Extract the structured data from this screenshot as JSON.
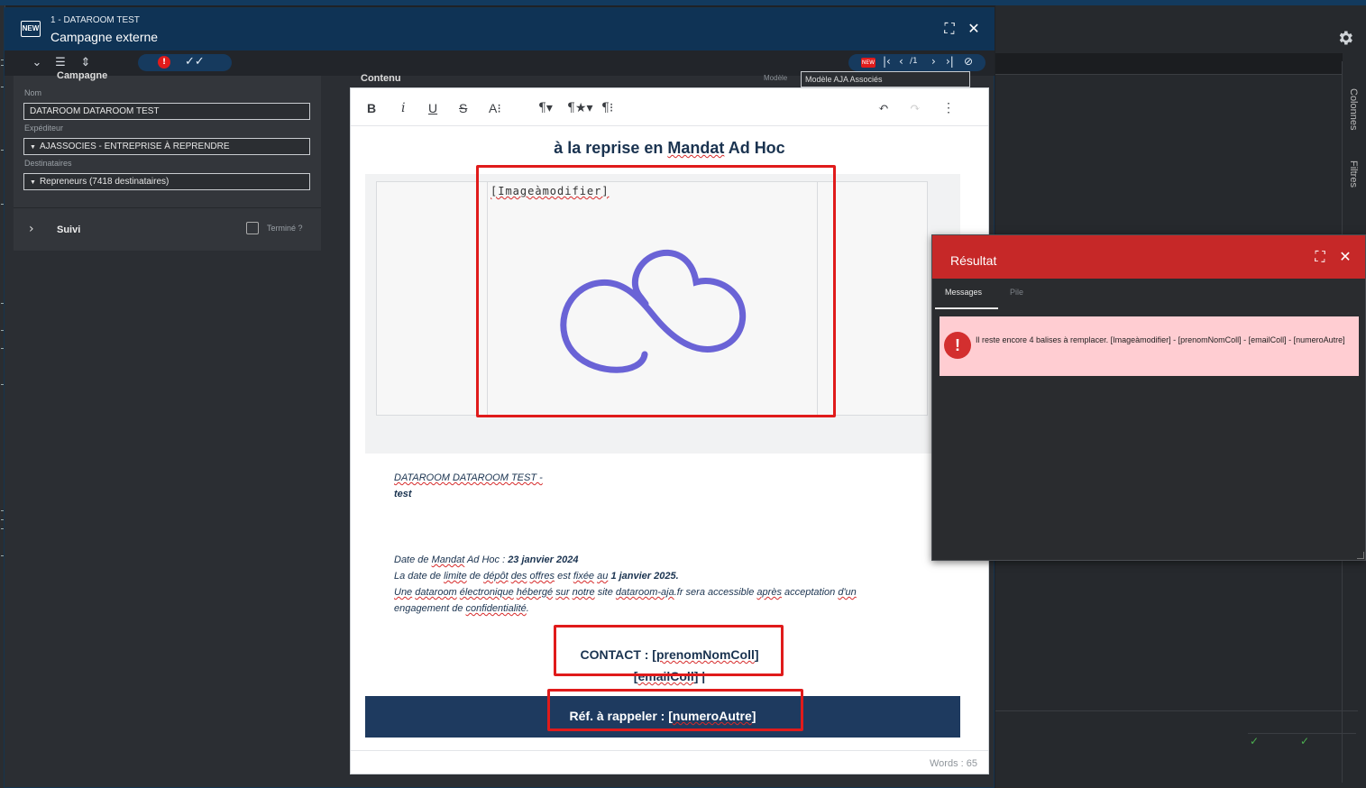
{
  "dialog": {
    "subtitle": "1 - DATAROOM TEST",
    "title": "Campagne externe",
    "new_badge": "NEW"
  },
  "toolbar": {
    "error_count": "!",
    "nav_page": "/1",
    "nav_badge": "NEW"
  },
  "form": {
    "section": "Campagne",
    "nom_label": "Nom",
    "nom_value": "DATAROOM DATAROOM TEST",
    "expediteur_label": "Expéditeur",
    "expediteur_value": "AJASSOCIES - ENTREPRISE À REPRENDRE",
    "destinataires_label": "Destinataires",
    "destinataires_value": "Repreneurs (7418 destinataires)",
    "suivi_label": "Suivi",
    "termine_label": "Terminé ?"
  },
  "editor": {
    "contenu_label": "Contenu",
    "modele_label": "Modèle",
    "modele_value": "Modèle AJA Associés",
    "heading_prefix": "à la reprise en ",
    "heading_mandat": "Mandat",
    "heading_suffix": " Ad Hoc",
    "image_placeholder": "[Imageàmodifier]",
    "company": "DATAROOM DATAROOM TEST -",
    "company_line2": "test",
    "line1_prefix": "Date de ",
    "line1_mandat": "Mandat",
    "line1_mid": " Ad Hoc : ",
    "line1_date": "23 janvier 2024",
    "line2_a": "La date de ",
    "line2_limite": "limite",
    "line2_b": " de ",
    "line2_depot": "dépôt",
    "line2_c": " ",
    "line2_des": "des",
    "line2_d": " ",
    "line2_offres": "offres",
    "line2_e": " est ",
    "line2_fixee": "fixée",
    "line2_f": " ",
    "line2_au": "au",
    "line2_g": " ",
    "line2_date": "1 janvier 2025.",
    "line3_une": "Une",
    "line3_a": " ",
    "line3_dataroom": "dataroom",
    "line3_b": " ",
    "line3_electronique": "électronique",
    "line3_c": " ",
    "line3_heberge": "hébergé",
    "line3_d": " ",
    "line3_sur": "sur",
    "line3_e": " ",
    "line3_notre": "notre",
    "line3_f": " site ",
    "line3_site": "dataroom-aja",
    "line3_g": ".fr sera accessible ",
    "line3_apres": "après",
    "line3_h": " acceptation ",
    "line3_dun": "d'un",
    "line4_a": "engagement de ",
    "line4_conf": "confidentialité",
    "line4_b": ".",
    "contact_prefix": "CONTACT : [",
    "contact_name": "prenomNomColl",
    "contact_suffix": "]",
    "contact_line2_prefix": "[",
    "contact_email": "emailColl",
    "contact_line2_suffix": "] |",
    "ref_prefix": "Réf. à rappeler : [",
    "ref_num": "numeroAutre",
    "ref_suffix": "]",
    "words": "Words : 65"
  },
  "result": {
    "title": "Résultat",
    "tab_messages": "Messages",
    "tab_pile": "Pile",
    "message": "Il reste encore 4 balises à remplacer. [Imageàmodifier] - [prenomNomColl] - [emailColl] - [numeroAutre]",
    "error_symbol": "!"
  },
  "background": {
    "vtab_colonnes": "Colonnes",
    "vtab_filtres": "Filtres"
  },
  "colors": {
    "header_blue": "#0f3355",
    "result_red": "#c62828",
    "highlight_red": "#e01b1b",
    "ref_bar": "#1e3a5f",
    "logo_purple": "#6a63d6"
  }
}
